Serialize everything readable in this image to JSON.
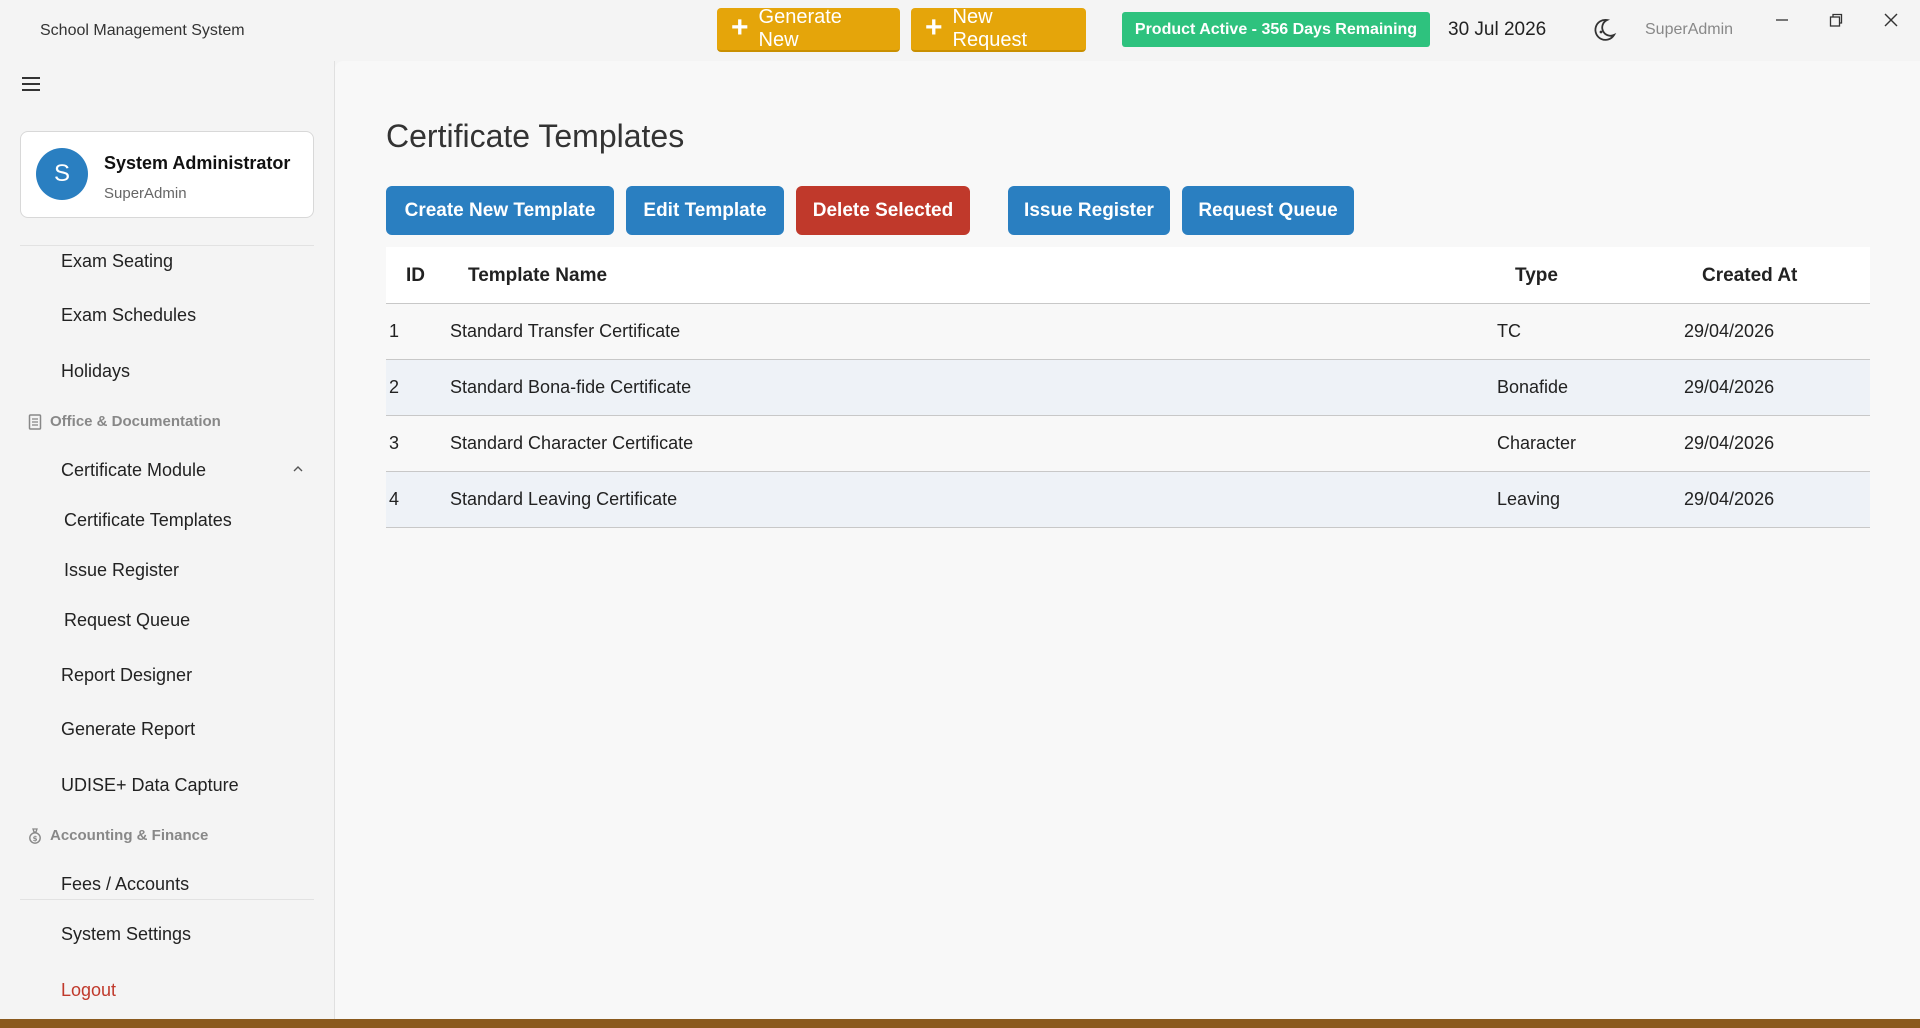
{
  "titlebar": {
    "app_title": "School Management System",
    "generate_label": "Generate New",
    "new_request_label": "New Request",
    "status": "Product Active - 356 Days Remaining",
    "date": "30 Jul 2026",
    "user": "SuperAdmin"
  },
  "sidebar": {
    "profile": {
      "initial": "S",
      "name": "System Administrator",
      "role": "SuperAdmin"
    },
    "items": {
      "exam_seating": "Exam Seating",
      "exam_schedules": "Exam Schedules",
      "holidays": "Holidays",
      "section_office": "Office & Documentation",
      "certificate_module": "Certificate Module",
      "certificate_templates": "Certificate Templates",
      "issue_register": "Issue Register",
      "request_queue": "Request Queue",
      "report_designer": "Report Designer",
      "generate_report": "Generate Report",
      "udise": "UDISE+ Data Capture",
      "section_accounting": "Accounting & Finance",
      "fees": "Fees / Accounts",
      "system_settings": "System Settings",
      "logout": "Logout"
    }
  },
  "main": {
    "title": "Certificate Templates",
    "buttons": {
      "create": "Create New Template",
      "edit": "Edit Template",
      "delete": "Delete Selected",
      "issue_register": "Issue Register",
      "request_queue": "Request Queue"
    },
    "table": {
      "headers": {
        "id": "ID",
        "name": "Template Name",
        "type": "Type",
        "created": "Created At"
      },
      "rows": [
        {
          "id": "1",
          "name": "Standard Transfer Certificate",
          "type": "TC",
          "created": "29/04/2026"
        },
        {
          "id": "2",
          "name": "Standard Bona-fide Certificate",
          "type": "Bonafide",
          "created": "29/04/2026"
        },
        {
          "id": "3",
          "name": "Standard Character Certificate",
          "type": "Character",
          "created": "29/04/2026"
        },
        {
          "id": "4",
          "name": "Standard Leaving Certificate",
          "type": "Leaving",
          "created": "29/04/2026"
        }
      ]
    }
  },
  "colors": {
    "accent_orange": "#e5a50a",
    "status_green": "#2ec27e",
    "primary_blue": "#2a7fc1",
    "danger_red": "#c0392b"
  }
}
